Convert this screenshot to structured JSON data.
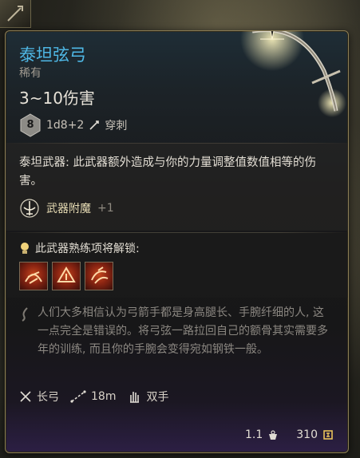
{
  "item": {
    "name": "泰坦弦弓",
    "rarity": "稀有",
    "damage_range": "3~10伤害",
    "die_face": "8",
    "damage_dice": "1d8+2",
    "damage_type": "穿刺",
    "description": "泰坦武器: 此武器额外造成与你的力量调整值数值相等的伤害。",
    "enchantment_label": "武器附魔",
    "enchantment_bonus": "+1",
    "proficiency_unlock": "此武器熟练项将解锁:",
    "skills": [
      "skill-icon-1",
      "skill-icon-2",
      "skill-icon-3"
    ],
    "lore": "人们大多相信认为弓箭手都是身高腿长、手腕纤细的人, 这一点完全是错误的。将弓弦一路拉回自己的额骨其实需要多年的训练, 而且你的手腕会变得宛如钢铁一般。",
    "weapon_type": "长弓",
    "range": "18m",
    "handedness": "双手",
    "weight": "1.1",
    "value": "310"
  },
  "colors": {
    "title": "#4fb8e6",
    "rarity": "#a09a90",
    "lore": "#8b8781",
    "border": "#8a7d55"
  }
}
